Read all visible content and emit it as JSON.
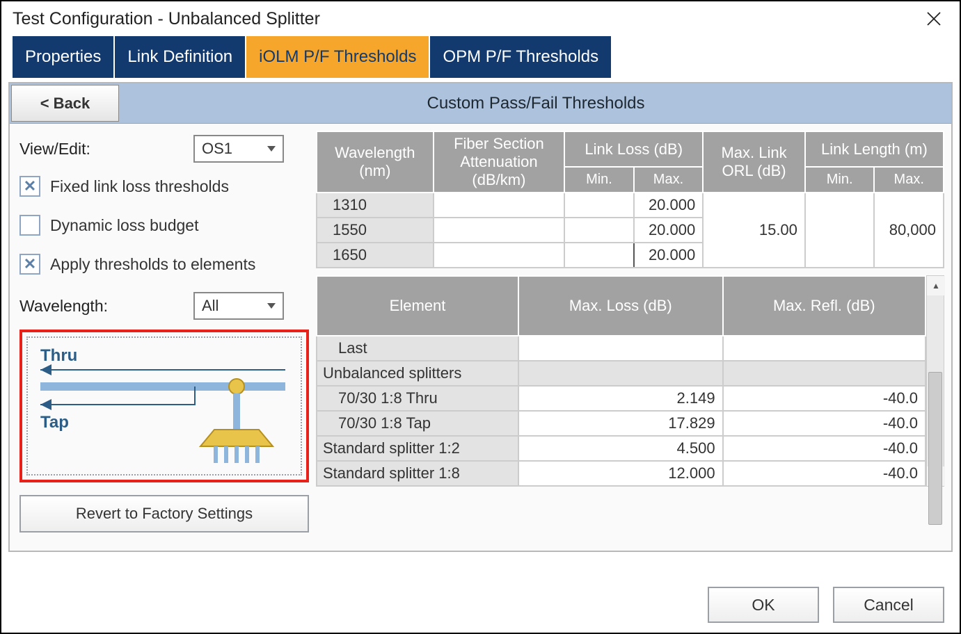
{
  "window": {
    "title": "Test Configuration - Unbalanced Splitter"
  },
  "tabs": [
    {
      "label": "Properties",
      "active": false
    },
    {
      "label": "Link Definition",
      "active": false
    },
    {
      "label": "iOLM P/F Thresholds",
      "active": true
    },
    {
      "label": "OPM P/F Thresholds",
      "active": false
    }
  ],
  "back_label": "< Back",
  "banner_title": "Custom Pass/Fail Thresholds",
  "left": {
    "view_edit_label": "View/Edit:",
    "view_edit_value": "OS1",
    "chk_fixed": {
      "label": "Fixed link loss thresholds",
      "checked": true
    },
    "chk_dynamic": {
      "label": "Dynamic loss budget",
      "checked": false
    },
    "chk_apply": {
      "label": "Apply thresholds to elements",
      "checked": true
    },
    "wavelength_label": "Wavelength:",
    "wavelength_value": "All",
    "diagram": {
      "thru": "Thru",
      "tap": "Tap"
    },
    "revert_label": "Revert to Factory Settings"
  },
  "table1": {
    "headers": {
      "wavelength": "Wavelength (nm)",
      "fiber_atten": "Fiber Section Attenuation (dB/km)",
      "link_loss": "Link Loss (dB)",
      "link_loss_min": "Min.",
      "link_loss_max": "Max.",
      "max_orl": "Max. Link ORL (dB)",
      "link_length": "Link Length (m)",
      "link_length_min": "Min.",
      "link_length_max": "Max."
    },
    "rows": [
      {
        "wavelength": "1310",
        "fiber_atten": "",
        "ll_min": "",
        "ll_max": "20.000"
      },
      {
        "wavelength": "1550",
        "fiber_atten": "",
        "ll_min": "",
        "ll_max": "20.000"
      },
      {
        "wavelength": "1650",
        "fiber_atten": "",
        "ll_min": "",
        "ll_max": "20.000"
      }
    ],
    "max_orl_value": "15.00",
    "len_min": "",
    "len_max": "80,000"
  },
  "table2": {
    "headers": {
      "element": "Element",
      "max_loss": "Max. Loss (dB)",
      "max_refl": "Max. Refl. (dB)"
    },
    "rows": [
      {
        "element": "Last",
        "indent": true,
        "loss": "",
        "refl": ""
      },
      {
        "element": "Unbalanced splitters",
        "section": true
      },
      {
        "element": "70/30 1:8 Thru",
        "indent": true,
        "loss": "2.149",
        "refl": "-40.0"
      },
      {
        "element": "70/30 1:8 Tap",
        "indent": true,
        "loss": "17.829",
        "refl": "-40.0"
      },
      {
        "element": "Standard splitter 1:2",
        "loss": "4.500",
        "refl": "-40.0"
      },
      {
        "element": "Standard splitter 1:8",
        "loss": "12.000",
        "refl": "-40.0"
      }
    ]
  },
  "footer": {
    "ok": "OK",
    "cancel": "Cancel"
  }
}
